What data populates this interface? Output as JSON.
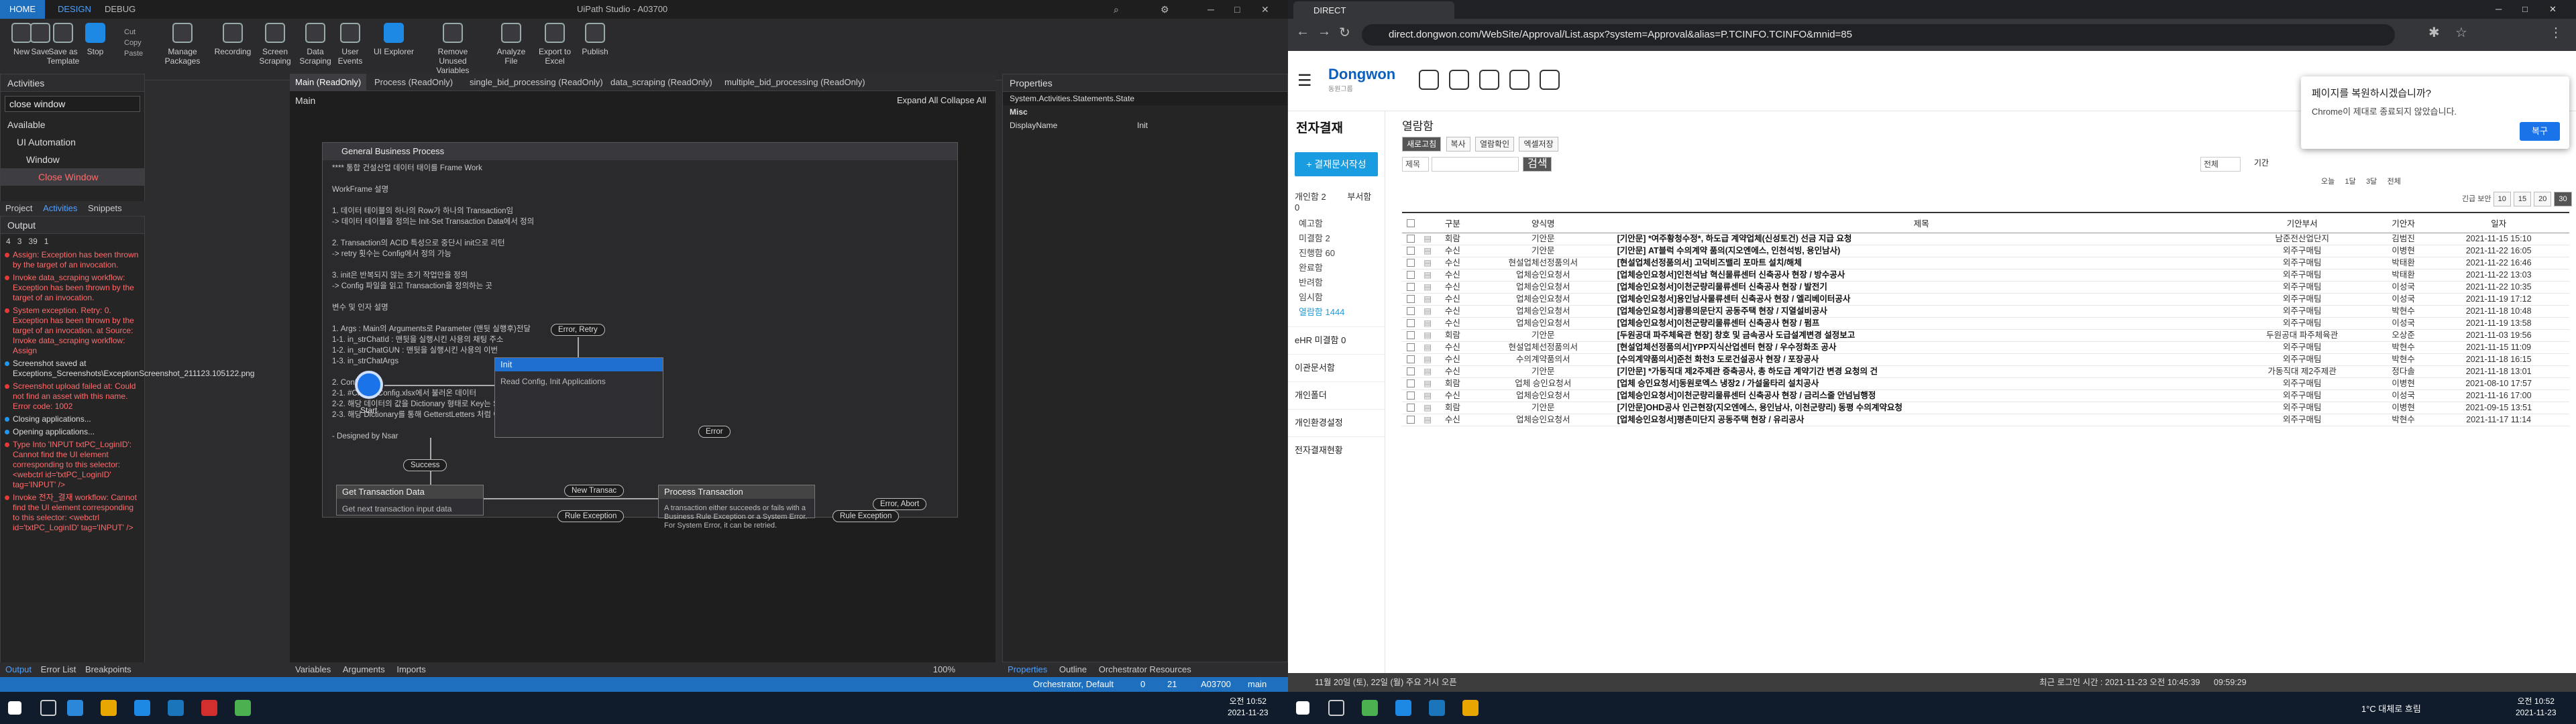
{
  "studio": {
    "tabs": [
      "HOME",
      "DESIGN",
      "DEBUG"
    ],
    "title": "UiPath Studio - A03700",
    "ribbon": [
      "New",
      "Save",
      "Save as Template",
      "Stop",
      "Manage Packages",
      "Recording",
      "Screen Scraping",
      "Data Scraping",
      "User Events",
      "UI Explorer",
      "Remove Unused Variables",
      "Analyze File",
      "Export to Excel",
      "Publish"
    ],
    "ribbon_small": [
      "Cut",
      "Copy",
      "Paste"
    ],
    "activities": {
      "title": "Activities",
      "search": "close window",
      "tree": [
        "Available",
        "UI Automation",
        "Window",
        "Close Window"
      ]
    },
    "panel_tabs": [
      "Project",
      "Activities",
      "Snippets"
    ],
    "doc_tabs": [
      "Main (ReadOnly)",
      "Process (ReadOnly)",
      "single_bid_processing (ReadOnly)",
      "data_scraping (ReadOnly)",
      "multiple_bid_processing (ReadOnly)"
    ],
    "breadcrumb": "Main",
    "expand_links": "Expand All   Collapse All",
    "sequence_title": "General Business Process",
    "comment": "**** 통합 건설산업 데이터 태이를 Frame Work\n\nWorkFrame 설명\n\n1. 데이터 테이블의 하나의 Row가 하나의 Transaction임\n-> 데이터 테이블을 정의는 Init-Set Transaction Data에서 정의\n\n2. Transaction의 ACID 특성으로 중단시 init으로 리턴\n-> retry 횟수는 Config에서 정의 가능\n\n3. init은 반복되지 않는 초기 작업만을 정의\n-> Config 파일을 읽고 Transaction을 정의하는 곳\n\n변수 및 인자 설명\n\n1. Args : Main의 Arguments로 Parameter (맨뒷 실행후)전달\n1-1. in_strChatId : 맨뒷을 실행시킨 사용의 채팅 주소\n1-2. in_strChatGUN : 맨뒷을 실행시킨 사용의 이번\n1-3. in_strChatArgs\n\n2. Config\n2-1. #Clucid#Config.xlsx에서 불러온 데이터\n2-2. 해당 데이터의 값을 Dictionary 형태로 Key는 String, Item은 Object로 정의\n2-3. 해당 Dictionary를 통해 GetterstLetters 처럼 이용 가능\n\n- Designed by Nsar",
    "nodes": {
      "init": "Init",
      "init_body": "Read Config, Init Applications",
      "gtd": "Get Transaction Data",
      "gtd_body": "Get next transaction input data",
      "proc": "Process Transaction",
      "proc_body": "A transaction either succeeds or fails with a Business Rule Exception or a System Error. For System Error, it can be retried."
    },
    "pills": [
      "Error, Retry",
      "Success",
      "Error",
      "New Transac",
      "Rule Exception",
      "Rule Exception",
      "Error, Abort"
    ],
    "start_label": "Start",
    "bottom_tabs": [
      "Variables",
      "Arguments",
      "Imports"
    ],
    "zoom": "100%",
    "output": {
      "title": "Output",
      "counts": [
        "4",
        "3",
        "39",
        "1"
      ],
      "lines": [
        {
          "type": "err",
          "text": "Assign: Exception has been thrown by the target of an invocation."
        },
        {
          "type": "err",
          "text": "Invoke data_scraping workflow: Exception has been thrown by the target of an invocation."
        },
        {
          "type": "err",
          "text": "System exception. Retry: 0. Exception has been thrown by the target of an invocation. at Source: Invoke data_scraping workflow: Assign"
        },
        {
          "type": "info",
          "text": "Screenshot saved at Exceptions_Screenshots\\ExceptionScreenshot_211123.105122.png"
        },
        {
          "type": "err",
          "text": "Screenshot upload failed at: Could not find an asset with this name. Error code: 1002"
        },
        {
          "type": "info",
          "text": "Closing applications..."
        },
        {
          "type": "info",
          "text": "Opening applications..."
        },
        {
          "type": "err",
          "text": "Type Into 'INPUT  txtPC_LoginID': Cannot find the UI element corresponding to this selector: <webctrl id='txtPC_LoginID' tag='INPUT' />"
        },
        {
          "type": "err",
          "text": "Invoke 전자_결재 workflow: Cannot find the UI element corresponding to this selector: <webctrl id='txtPC_LoginID' tag='INPUT' />"
        }
      ]
    },
    "output_tabs": [
      "Output",
      "Error List",
      "Breakpoints"
    ],
    "properties": {
      "title": "Properties",
      "type": "System.Activities.Statements.State",
      "group": "Misc",
      "row_name": "DisplayName",
      "row_value": "Init"
    },
    "prop_tabs": [
      "Properties",
      "Outline",
      "Orchestrator Resources"
    ],
    "status": {
      "orch": "Orchestrator, Default",
      "a": "0",
      "b": "21",
      "project": "A03700",
      "branch": "main"
    }
  },
  "chrome": {
    "tab_title": "DIRECT",
    "url": "direct.dongwon.com/WebSite/Approval/List.aspx?system=Approval&alias=P.TCINFO.TCINFO&mnid=85",
    "popup": {
      "title": "페이지를 복원하시겠습니까?",
      "body": "Chrome이 제대로 종료되지 않았습니다.",
      "button": "복구"
    },
    "logo": "Dongwon",
    "logo_sub": "동원그룹",
    "sidebar": {
      "title": "전자결재",
      "button": "+ 결재문서작성",
      "tabs": [
        "개인함 2",
        "부서함 0"
      ],
      "items": [
        "예고함",
        "미결함 2",
        "진행함 60",
        "완료함",
        "반려함",
        "임시함",
        "열람함 1444"
      ],
      "sections": [
        "eHR 미결함 0",
        "이관문서함",
        "개인폴더",
        "개인환경설정",
        "전자결재현황"
      ]
    },
    "content": {
      "title": "열람함",
      "tools": [
        "새로고침",
        "복사",
        "열람확인",
        "엑셀저장"
      ],
      "filter1": "제목",
      "filter2": "전체",
      "search": "검색",
      "period": "기간",
      "period_opts": [
        "오늘",
        "1달",
        "3달",
        "전체"
      ],
      "legend": "긴급  보안",
      "page_sizes": [
        "10",
        "15",
        "20",
        "30"
      ],
      "headers": [
        "",
        "",
        "구분",
        "양식명",
        "제목",
        "기안부서",
        "기안자",
        "일자"
      ],
      "rows": [
        [
          "회람",
          "기안문",
          "[기안문] *여주황청수정*, 하도급 계약업체(신성토건) 선금 지급 요청",
          "남준전산업단지",
          "김범진",
          "2021-11-15 15:10"
        ],
        [
          "수신",
          "기안문",
          "[기안문] AT블럭 수의계약 품의(지오엔에스, 인천석빙, 용인남사)",
          "외주구매팀",
          "이병현",
          "2021-11-22 16:05"
        ],
        [
          "수신",
          "현설업체선정품의서",
          "[현설업체선정품의서] 고덕비즈밸리 포마트 설치/해체",
          "외주구매팀",
          "박태환",
          "2021-11-22 16:46"
        ],
        [
          "수신",
          "업체승인요청서",
          "[업체승인요청서]인천석남 혁신물류센터 신축공사 현장 / 방수공사",
          "외주구매팀",
          "박태환",
          "2021-11-22 13:03"
        ],
        [
          "수신",
          "업체승인요청서",
          "[업체승인요청서]이천군량리물류센터 신축공사 현장 / 발전기",
          "외주구매팀",
          "이성국",
          "2021-11-22 10:35"
        ],
        [
          "수신",
          "업체승인요청서",
          "[업체승인요청서]용인남사물류센터 신축공사 현장 / 엘리베이터공사",
          "외주구매팀",
          "이성국",
          "2021-11-19 17:12"
        ],
        [
          "수신",
          "업체승인요청서",
          "[업체승인요청서]광릉의문단지 공동주택 현장 / 지열설비공사",
          "외주구매팀",
          "박현수",
          "2021-11-18 10:48"
        ],
        [
          "수신",
          "업체승인요청서",
          "[업체승인요청서]이천군량리물류센터 신축공사 현장 / 펌프",
          "외주구매팀",
          "이성국",
          "2021-11-19 13:58"
        ],
        [
          "회람",
          "기안문",
          "[두원공대 파주체육관 현장] 창호 및 금속공사 도급설계변경 설정보고",
          "두원공대 파주체육관",
          "오상준",
          "2021-11-03 19:56"
        ],
        [
          "수신",
          "현설업체선정품의서",
          "[현설업체선정품의서]YPP지식산업센터 현장 / 우수정화조 공사",
          "외주구매팀",
          "박현수",
          "2021-11-15 11:09"
        ],
        [
          "수신",
          "수의계약품의서",
          "[수의계약품의서]준천 화천3 도로건설공사 현장 / 포장공사",
          "외주구매팀",
          "박현수",
          "2021-11-18 16:15"
        ],
        [
          "수신",
          "기안문",
          "[기안문] *가동직대 제2주제관 증축공사, 총 하도급 계약기간 변경 요청의 건",
          "가동직대 제2주제관",
          "정다솔",
          "2021-11-18 13:01"
        ],
        [
          "회람",
          "업체 승인요청서",
          "[업체 승인요청서]동원로엑스 냉장2 / 가설울타리 설치공사",
          "외주구매팀",
          "이병현",
          "2021-08-10 17:57"
        ],
        [
          "수신",
          "업체승인요청서",
          "[업체승인요청서]이천군량리물류센터 신축공사 현장 / 금리스줄 안넘님행정",
          "외주구매팀",
          "이성국",
          "2021-11-16 17:00"
        ],
        [
          "회람",
          "기안문",
          "[기안문]OHD공사 인근현장(지오엔에스, 용인남사, 이천군량리) 동평 수의계약요청",
          "외주구매팀",
          "이병현",
          "2021-09-15 13:51"
        ],
        [
          "수신",
          "업체승인요청서",
          "[업체승인요청서]평촌미단지 공동주택 현장 / 유리공사",
          "외주구매팀",
          "박현수",
          "2021-11-17 11:14"
        ]
      ]
    },
    "status": {
      "date": "11월 20일 (토), 22일 (월) 주요 거시 오픈",
      "login": "최근 로그인 시간 : 2021-11-23 오전 10:45:39",
      "time": "09:59:29"
    }
  },
  "taskbar": {
    "time": "오전 10:52",
    "date": "2021-11-23",
    "weather": "1°C 대체로 흐림"
  }
}
